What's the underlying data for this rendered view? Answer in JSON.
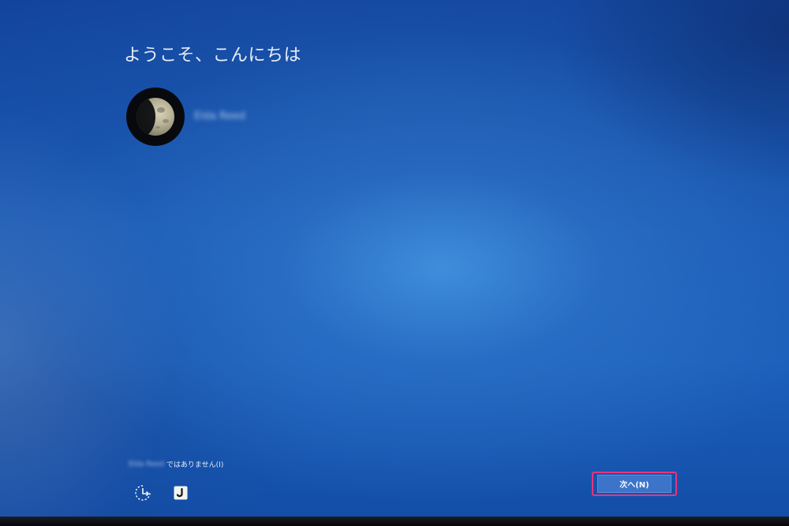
{
  "screen": {
    "greeting": "ようこそ、こんにちは",
    "account": {
      "name": "Elda Reed",
      "avatar_icon": "moon-photo"
    },
    "not_you": {
      "name": "Elda Reed",
      "text": "ではありません(I)"
    },
    "bottom_icons": [
      {
        "name": "ease-of-access-icon"
      },
      {
        "name": "ime-mode-icon"
      }
    ],
    "next_button": {
      "label": "次へ(N)"
    }
  }
}
